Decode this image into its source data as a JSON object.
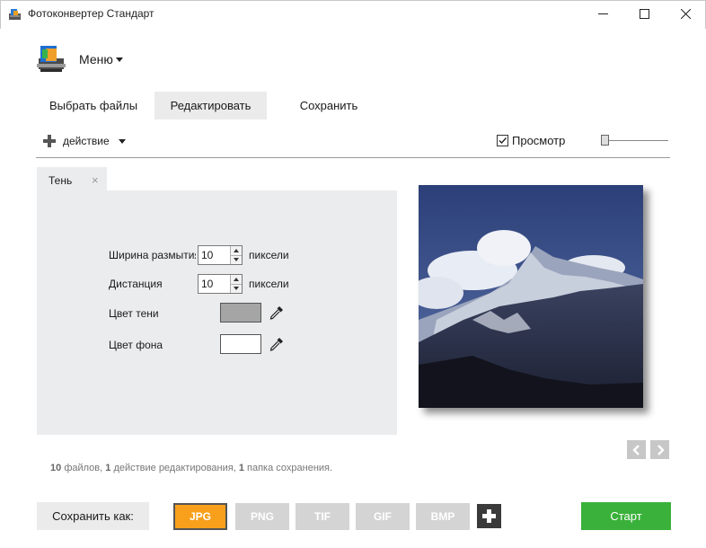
{
  "window": {
    "title": "Фотоконвертер Стандарт",
    "minimize_glyph": "—",
    "close_glyph": "✕"
  },
  "menu": {
    "label": "Меню"
  },
  "tabs": [
    {
      "label": "Выбрать файлы",
      "active": false
    },
    {
      "label": "Редактировать",
      "active": true
    },
    {
      "label": "Сохранить",
      "active": false
    }
  ],
  "toolbar": {
    "action_label": "действие",
    "preview_label": "Просмотр",
    "preview_checked": true
  },
  "panel": {
    "tab_label": "Тень",
    "tab_close": "×",
    "fields": {
      "blur_width": {
        "label": "Ширина размытия",
        "value": "10",
        "unit": "пиксели"
      },
      "distance": {
        "label": "Дистанция",
        "value": "10",
        "unit": "пиксели"
      },
      "shadow_color": {
        "label": "Цвет тени",
        "color": "#a5a5a5"
      },
      "bg_color": {
        "label": "Цвет фона",
        "color": "#ffffff"
      }
    }
  },
  "status": {
    "files_count": "10",
    "files_text": "файлов,",
    "actions_count": "1",
    "actions_text": "действие редактирования,",
    "folders_count": "1",
    "folders_text": "папка сохранения."
  },
  "bottom": {
    "save_as_label": "Сохранить как:",
    "formats": [
      {
        "label": "JPG",
        "active": true
      },
      {
        "label": "PNG",
        "active": false
      },
      {
        "label": "TIF",
        "active": false
      },
      {
        "label": "GIF",
        "active": false
      },
      {
        "label": "BMP",
        "active": false
      }
    ],
    "start_label": "Старт"
  },
  "colors": {
    "accent_orange": "#f8a01c",
    "start_green": "#3ab13a",
    "panel_bg": "#ebeced",
    "tab_active_bg": "#ebebeb",
    "format_inactive": "#d4d4d4"
  }
}
